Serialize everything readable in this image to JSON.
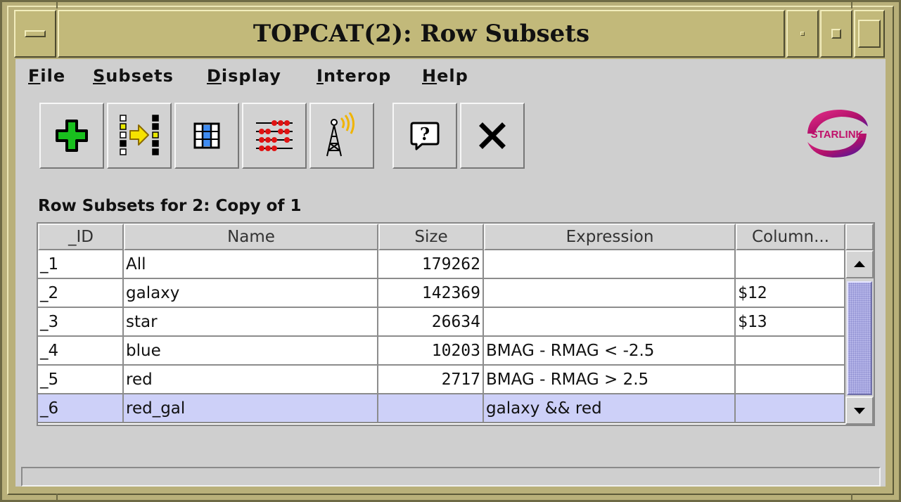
{
  "window": {
    "title": "TOPCAT(2): Row Subsets"
  },
  "menubar": {
    "items": [
      "File",
      "Subsets",
      "Display",
      "Interop",
      "Help"
    ]
  },
  "toolbar": {
    "buttons": [
      "add-subset",
      "transmit-subset",
      "highlight-subset",
      "subset-counts",
      "send-subset",
      "help",
      "close"
    ]
  },
  "logo": {
    "text": "STARLINK"
  },
  "table": {
    "title": "Row Subsets for 2: Copy of 1",
    "columns": [
      "_ID",
      "Name",
      "Size",
      "Expression",
      "Column..."
    ],
    "rows": [
      [
        "_1",
        "All",
        "179262",
        "",
        ""
      ],
      [
        "_2",
        "galaxy",
        "142369",
        "",
        "$12"
      ],
      [
        "_3",
        "star",
        "26634",
        "",
        "$13"
      ],
      [
        "_4",
        "blue",
        "10203",
        "BMAG - RMAG < -2.5",
        ""
      ],
      [
        "_5",
        "red",
        "2717",
        "BMAG - RMAG > 2.5",
        ""
      ],
      [
        "_6",
        "red_gal",
        "",
        "galaxy && red",
        ""
      ]
    ],
    "selected_row": 5
  },
  "colors": {
    "frame": "#b9b07a",
    "selection": "#cdd0f8",
    "scroll_thumb": "#b4b4e8"
  }
}
